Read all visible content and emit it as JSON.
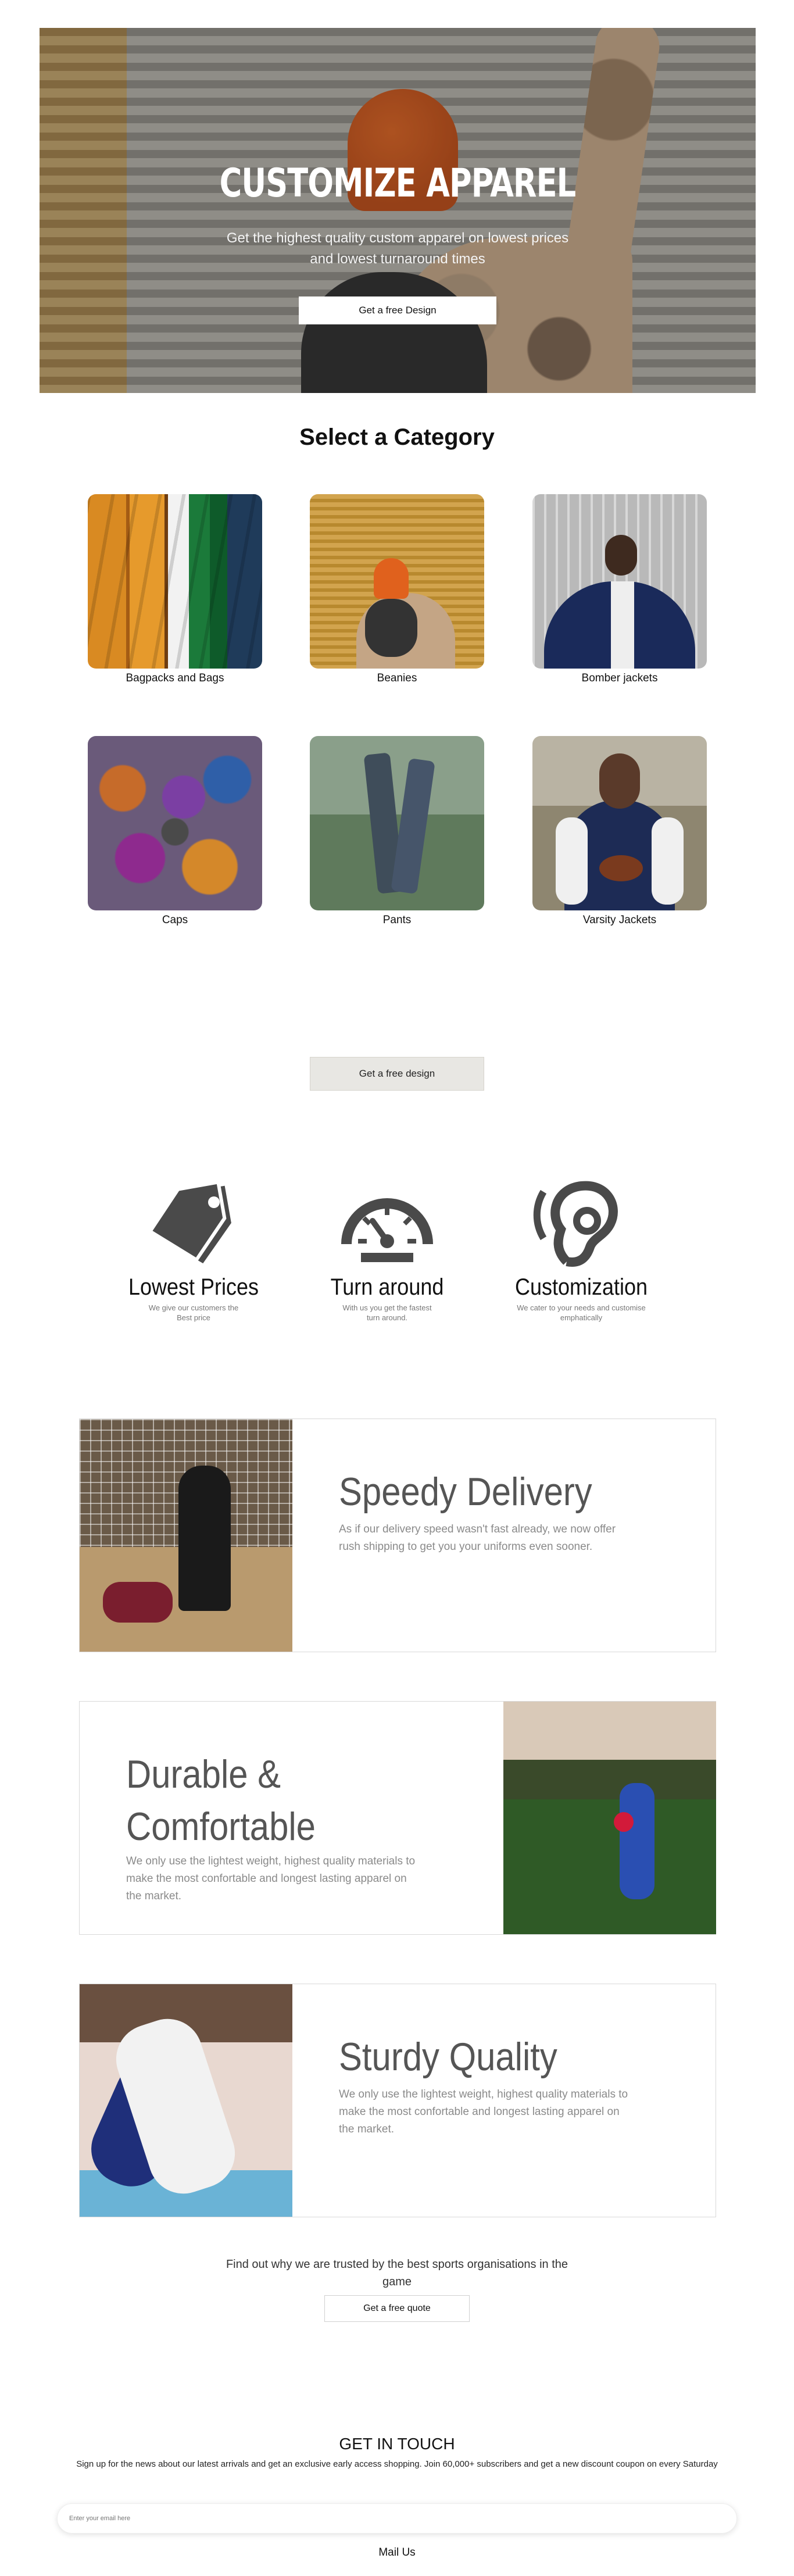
{
  "hero": {
    "title": "CUSTOMIZE APPAREL",
    "subtitle_line1": "Get the highest quality custom apparel on lowest prices",
    "subtitle_line2": "and lowest turnaround times",
    "button_label": "Get a free Design"
  },
  "categories": {
    "title": "Select a Category",
    "items": [
      {
        "label": "Bagpacks and Bags"
      },
      {
        "label": "Beanies"
      },
      {
        "label": "Bomber jackets"
      },
      {
        "label": "Caps"
      },
      {
        "label": "Pants"
      },
      {
        "label": "Varsity Jackets"
      }
    ],
    "cta_label": "Get a free design"
  },
  "features": [
    {
      "title": "Lowest Prices",
      "desc_line1": "We give our customers the",
      "desc_line2": "Best price",
      "icon": "price-tag-icon"
    },
    {
      "title": "Turn around",
      "desc_line1": "With us you get the fastest",
      "desc_line2": "turn around.",
      "icon": "speedometer-icon"
    },
    {
      "title": "Customization",
      "desc_line1": "We cater to your needs and customise",
      "desc_line2": "emphatically",
      "icon": "ear-icon"
    }
  ],
  "cards": [
    {
      "title": "Speedy Delivery",
      "desc_line1": "As if our delivery speed wasn't fast already, we now offer",
      "desc_line2": "rush shipping to get you your uniforms even sooner."
    },
    {
      "title_line1": "Durable &",
      "title_line2": "Comfortable",
      "desc_line1": "We only use the lightest weight, highest quality materials to",
      "desc_line2": "make the most confortable and longest lasting apparel on",
      "desc_line3": "the market."
    },
    {
      "title": "Sturdy Quality",
      "desc_line1": "We only use the lightest weight, highest quality materials to",
      "desc_line2": "make the most confortable and longest lasting apparel on",
      "desc_line3": "the market."
    }
  ],
  "trust": {
    "line1": "Find out why we are trusted by the best sports organisations in the",
    "line2": "game",
    "button_label": "Get a free quote"
  },
  "contact": {
    "title": "GET IN TOUCH",
    "subtitle": "Sign up for the news about our latest arrivals and get an exclusive early access shopping. Join 60,000+ subscribers and get a new discount coupon on every Saturday",
    "email_placeholder": "Enter your email here",
    "button_label": "Mail Us"
  }
}
